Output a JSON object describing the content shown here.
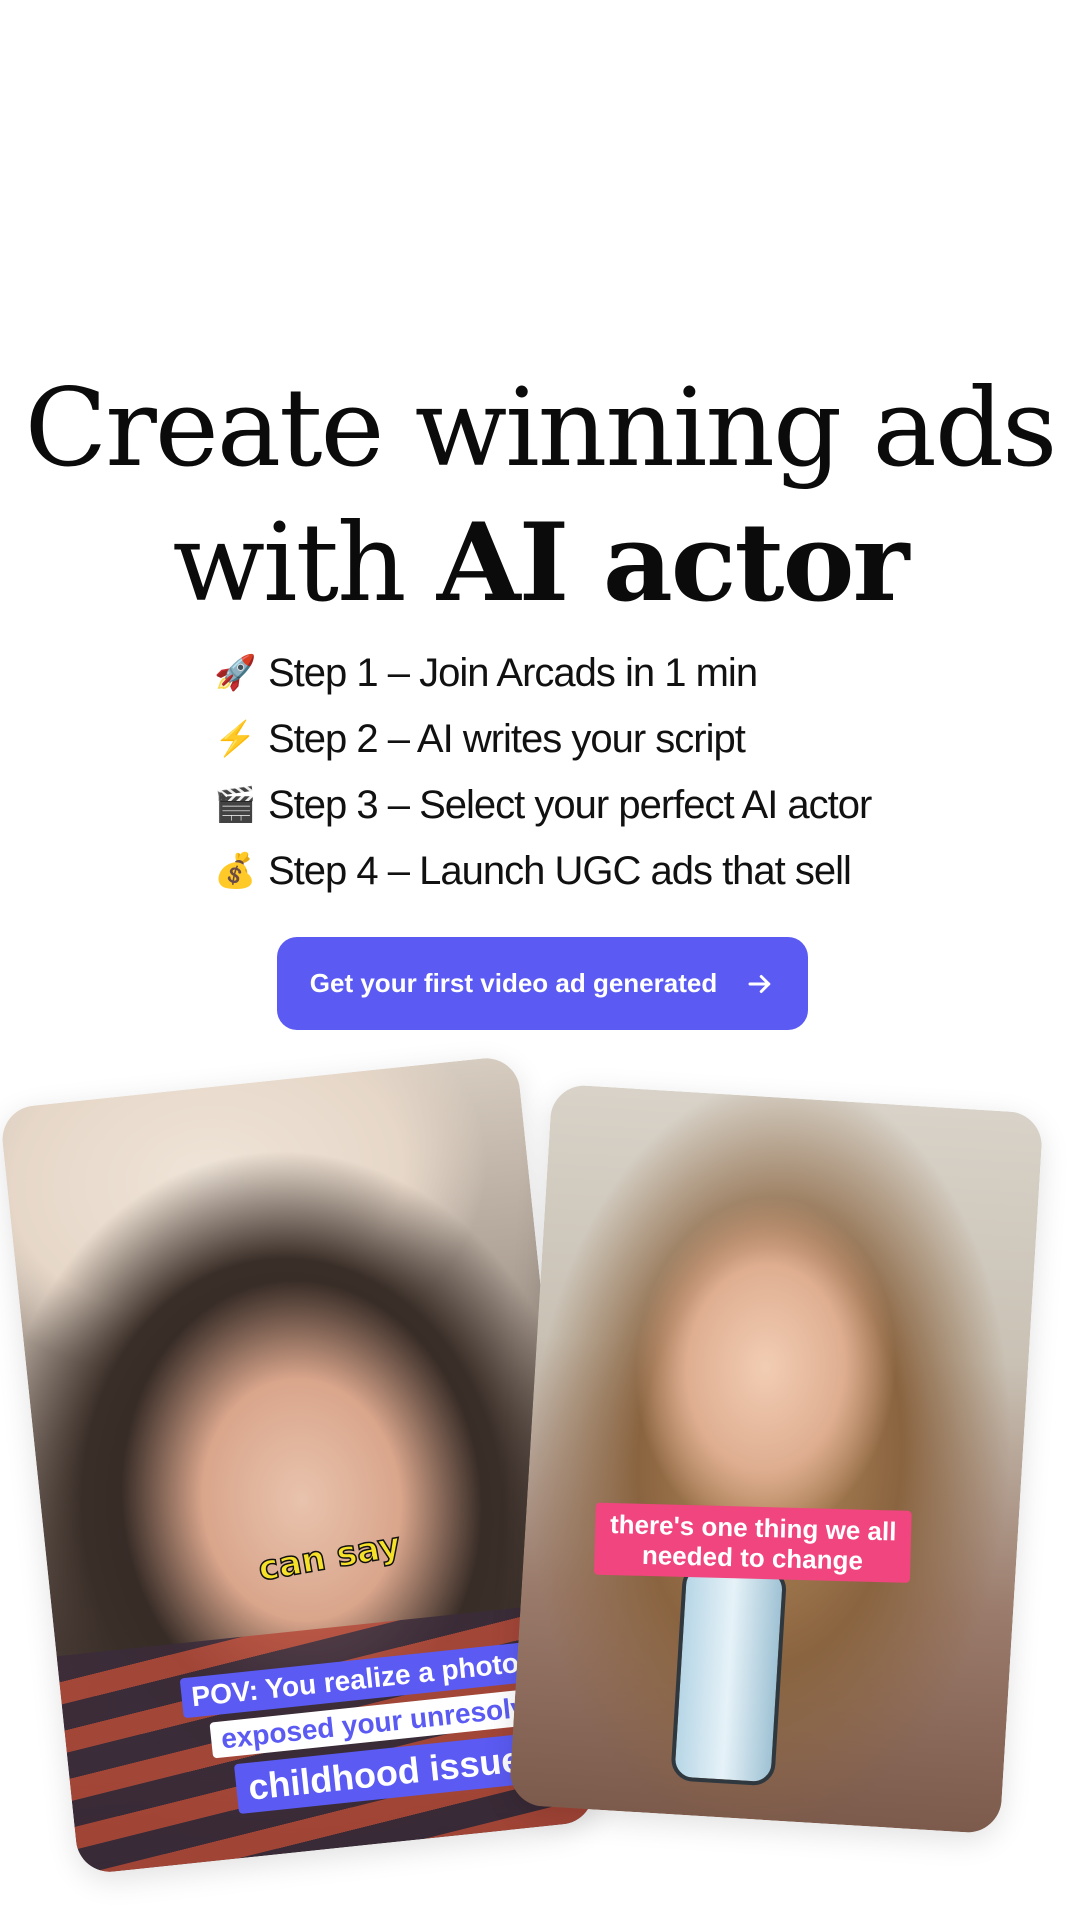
{
  "hero": {
    "headline_line1": "Create winning ads",
    "headline_with": "with",
    "headline_bold": "AI actor"
  },
  "steps": [
    {
      "icon": "rocket-icon",
      "emoji": "🚀",
      "text": "Step 1 – Join Arcads in 1 min"
    },
    {
      "icon": "lightning-icon",
      "emoji": "⚡",
      "text": "Step 2 – AI writes your script"
    },
    {
      "icon": "clapperboard-icon",
      "emoji": "🎬",
      "text": "Step 3 – Select your perfect AI actor"
    },
    {
      "icon": "money-bag-icon",
      "emoji": "💰",
      "text": "Step 4 – Launch UGC ads that sell"
    }
  ],
  "cta": {
    "label": "Get your first video ad generated",
    "color": "#5b5bf3"
  },
  "video_cards": {
    "left": {
      "caption_yellow": "can say",
      "caption_line1": "POV: You realize a photo just",
      "caption_line2": "exposed your unresolved",
      "caption_line3": "childhood issues"
    },
    "right": {
      "caption_pink": "there's one thing we all needed to change"
    }
  }
}
